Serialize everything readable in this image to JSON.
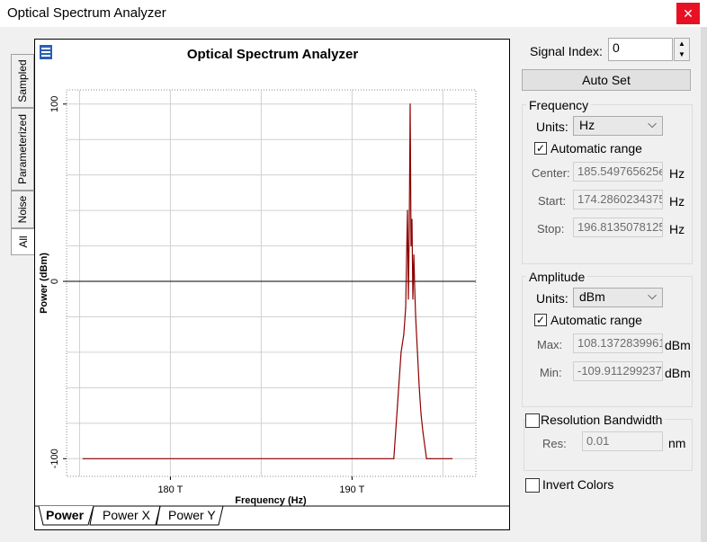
{
  "window": {
    "title": "Optical Spectrum Analyzer",
    "close": "✕"
  },
  "side_tabs": [
    "Sampled",
    "Parameterized",
    "Noise",
    "All"
  ],
  "chart": {
    "title": "Optical Spectrum Analyzer"
  },
  "bottom_tabs": [
    "Power",
    "Power X",
    "Power Y"
  ],
  "controls": {
    "signal_index_label": "Signal Index:",
    "signal_index_value": "0",
    "auto_set": "Auto Set",
    "frequency": {
      "title": "Frequency",
      "units_label": "Units:",
      "units_value": "Hz",
      "auto_range": "Automatic range",
      "center_label": "Center:",
      "center_value": "185.549765625e",
      "center_unit": "Hz",
      "start_label": "Start:",
      "start_value": "174.2860234375",
      "start_unit": "Hz",
      "stop_label": "Stop:",
      "stop_value": "196.8135078125",
      "stop_unit": "Hz"
    },
    "amplitude": {
      "title": "Amplitude",
      "units_label": "Units:",
      "units_value": "dBm",
      "auto_range": "Automatic range",
      "max_label": "Max:",
      "max_value": "108.1372839961",
      "max_unit": "dBm",
      "min_label": "Min:",
      "min_value": "-109.9112992379",
      "min_unit": "dBm"
    },
    "resolution": {
      "title": "Resolution Bandwidth",
      "res_label": "Res:",
      "res_value": "0.01",
      "res_unit": "nm"
    },
    "invert_colors": "Invert Colors"
  },
  "chart_data": {
    "type": "line",
    "title": "Optical Spectrum Analyzer",
    "xlabel": "Frequency (Hz)",
    "ylabel": "Power (dBm)",
    "xticks": [
      "180 T",
      "190 T"
    ],
    "yticks": [
      "100",
      "0",
      "-100"
    ],
    "xlim": [
      174.286,
      196.8135
    ],
    "ylim": [
      -110,
      108
    ],
    "grid": true,
    "color": "#8b0000",
    "series": [
      {
        "x": [
          175.2,
          192.3,
          192.5,
          192.7,
          192.85,
          192.95,
          193.05,
          193.1,
          193.15,
          193.2,
          193.25,
          193.3,
          193.35,
          193.4,
          193.45,
          193.5,
          193.6,
          193.7,
          193.8,
          193.9,
          194.1,
          194.3,
          195.5
        ],
        "y": [
          -100,
          -100,
          -70,
          -40,
          -30,
          -15,
          40,
          -10,
          30,
          100,
          20,
          35,
          -10,
          15,
          -5,
          -20,
          -40,
          -60,
          -75,
          -85,
          -100,
          -100,
          -100
        ]
      }
    ]
  }
}
